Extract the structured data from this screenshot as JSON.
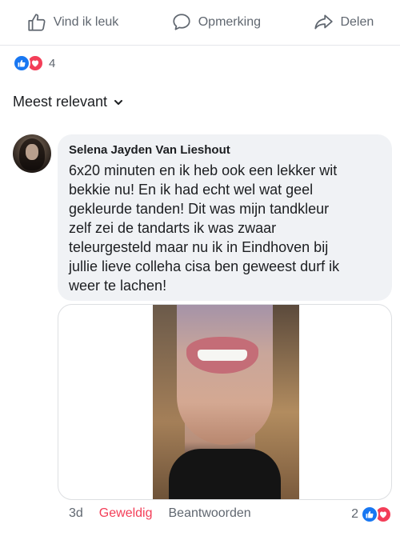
{
  "actions": {
    "like_label": "Vind ik leuk",
    "comment_label": "Opmerking",
    "share_label": "Delen"
  },
  "reactions": {
    "count": "4",
    "icons": [
      "like-icon",
      "love-icon"
    ],
    "colors": {
      "like": "#1877f2",
      "love": "#f33e58"
    }
  },
  "sort": {
    "label": "Meest relevant"
  },
  "comment": {
    "author": "Selena Jayden Van Lieshout",
    "text": "6x20 minuten en ik heb ook een lekker wit\nbekkie nu! En ik had echt wel wat geel\ngekleurde tanden! Dit was mijn tandkleur\nzelf zei de tandarts ik was zwaar\nteleurgesteld maar nu ik in Eindhoven bij\njullie lieve colleha cisa ben geweest durf ik\nweer te lachen!",
    "time": "3d",
    "reaction_word": "Geweldig",
    "reply_label": "Beantwoorden",
    "reaction_count": "2"
  }
}
